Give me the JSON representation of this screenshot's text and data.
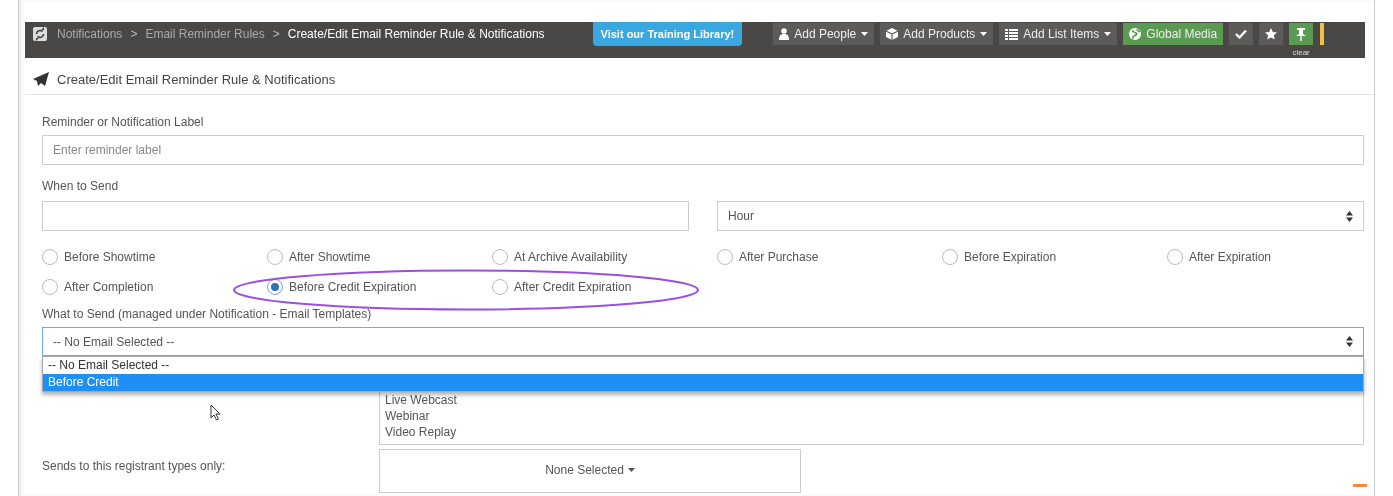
{
  "breadcrumbs": [
    {
      "label": "Notifications",
      "current": false
    },
    {
      "label": "Email Reminder Rules",
      "current": false
    },
    {
      "label": "Create/Edit Email Reminder Rule & Notifications",
      "current": true
    }
  ],
  "breadcrumb_separator": ">",
  "training_link": "Visit our Training Library!",
  "toolbar": [
    {
      "label": "Add People",
      "kind": "person",
      "color": "#5d5b59",
      "dropdown": true
    },
    {
      "label": "Add Products",
      "kind": "box",
      "color": "#5d5b59",
      "dropdown": true
    },
    {
      "label": "Add List Items",
      "kind": "list",
      "color": "#5d5b59",
      "dropdown": true
    },
    {
      "label": "Global Media",
      "kind": "globe",
      "color": "#5b9a52",
      "dropdown": false
    },
    {
      "kind": "check",
      "color": "#5d5b59"
    },
    {
      "kind": "star",
      "color": "#5d5b59"
    },
    {
      "kind": "pin",
      "color": "#5b9a52",
      "caption": "clear"
    }
  ],
  "panel_title": "Create/Edit Email Reminder Rule & Notifications",
  "reminder_label": {
    "label": "Reminder or Notification Label",
    "placeholder": "Enter reminder label"
  },
  "when_to_send": {
    "label": "When to Send",
    "unit": "Hour"
  },
  "send_timing": [
    {
      "label": "Before Showtime",
      "selected": false
    },
    {
      "label": "After Showtime",
      "selected": false
    },
    {
      "label": "At Archive Availability",
      "selected": false
    },
    {
      "label": "After Purchase",
      "selected": false
    },
    {
      "label": "Before Expiration",
      "selected": false
    },
    {
      "label": "After Expiration",
      "selected": false
    },
    {
      "label": "After Completion",
      "selected": false
    },
    {
      "label": "Before Credit Expiration",
      "selected": true
    },
    {
      "label": "After Credit Expiration",
      "selected": false
    }
  ],
  "what_to_send": {
    "label": "What to Send (managed under Notification - Email Templates)",
    "value": "-- No Email Selected --",
    "expanded": true,
    "options": [
      {
        "label": "-- No Email Selected --",
        "highlighted": false
      },
      {
        "label": "Before Credit",
        "highlighted": true
      }
    ]
  },
  "listbox_1": [
    "Live Webcast",
    "Webinar",
    "Video Replay"
  ],
  "registrant_types": {
    "label": "Sends to this registrant types only:",
    "button": "None Selected"
  }
}
